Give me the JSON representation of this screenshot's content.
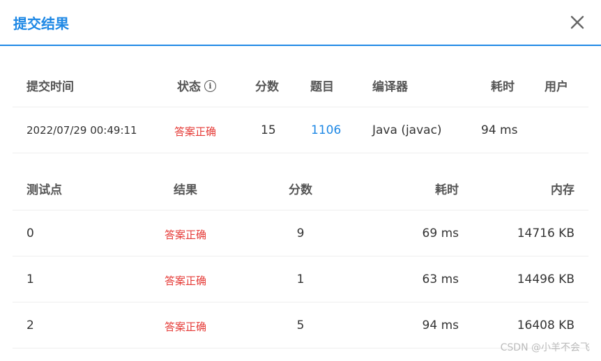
{
  "dialog": {
    "title": "提交结果",
    "close_icon": "close-icon"
  },
  "submission": {
    "headers": {
      "time": "提交时间",
      "status": "状态",
      "score": "分数",
      "problem": "题目",
      "compiler": "编译器",
      "elapsed": "耗时",
      "user": "用户"
    },
    "row": {
      "time": "2022/07/29 00:49:11",
      "status": "答案正确",
      "score": "15",
      "problem": "1106",
      "compiler": "Java (javac)",
      "elapsed": "94 ms",
      "user": ""
    }
  },
  "testcases": {
    "headers": {
      "point": "测试点",
      "result": "结果",
      "score": "分数",
      "elapsed": "耗时",
      "memory": "内存"
    },
    "rows": [
      {
        "point": "0",
        "result": "答案正确",
        "score": "9",
        "elapsed": "69 ms",
        "memory": "14716 KB"
      },
      {
        "point": "1",
        "result": "答案正确",
        "score": "1",
        "elapsed": "63 ms",
        "memory": "14496 KB"
      },
      {
        "point": "2",
        "result": "答案正确",
        "score": "5",
        "elapsed": "94 ms",
        "memory": "16408 KB"
      }
    ]
  },
  "watermark": "CSDN @小羊不会飞",
  "colors": {
    "accent": "#1e88e5",
    "success_text": "#e53935"
  }
}
